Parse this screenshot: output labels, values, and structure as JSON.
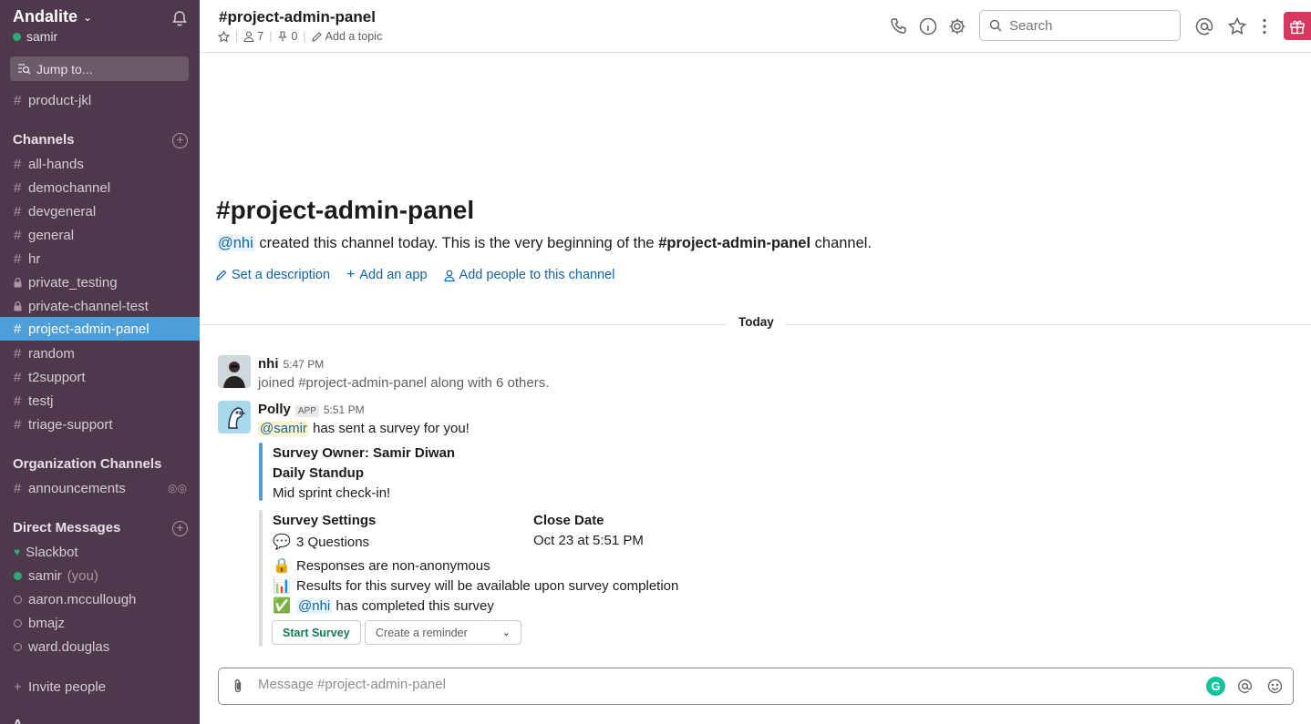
{
  "sidebar": {
    "team_name": "Andalite",
    "user": "samir",
    "jump_placeholder": "Jump to...",
    "pinned": [
      {
        "label": "product-jkl"
      }
    ],
    "channels_title": "Channels",
    "channels": [
      {
        "label": "all-hands",
        "type": "public"
      },
      {
        "label": "demochannel",
        "type": "public"
      },
      {
        "label": "devgeneral",
        "type": "public"
      },
      {
        "label": "general",
        "type": "public"
      },
      {
        "label": "hr",
        "type": "public"
      },
      {
        "label": "private_testing",
        "type": "private"
      },
      {
        "label": "private-channel-test",
        "type": "private"
      },
      {
        "label": "project-admin-panel",
        "type": "public",
        "active": true
      },
      {
        "label": "random",
        "type": "public"
      },
      {
        "label": "t2support",
        "type": "public"
      },
      {
        "label": "testj",
        "type": "public"
      },
      {
        "label": "triage-support",
        "type": "public"
      }
    ],
    "org_title": "Organization Channels",
    "org_channels": [
      {
        "label": "announcements"
      }
    ],
    "dm_title": "Direct Messages",
    "dms": [
      {
        "label": "Slackbot",
        "status": "bot"
      },
      {
        "label": "samir",
        "suffix": "(you)",
        "status": "online"
      },
      {
        "label": "aaron.mccullough",
        "status": "offline"
      },
      {
        "label": "bmajz",
        "status": "offline"
      },
      {
        "label": "ward.douglas",
        "status": "offline"
      }
    ],
    "invite_label": "Invite people",
    "bottom_section_partial": "A"
  },
  "header": {
    "channel_name": "#project-admin-panel",
    "member_count": "7",
    "pin_count": "0",
    "add_topic": "Add a topic",
    "search_placeholder": "Search"
  },
  "intro": {
    "title": "#project-admin-panel",
    "creator": "@nhi",
    "text_before": " created this channel today. This is the very beginning of the ",
    "channel_bold": "#project-admin-panel",
    "text_after": " channel.",
    "actions": {
      "set_description": "Set a description",
      "add_app": "Add an app",
      "add_people": "Add people to this channel"
    }
  },
  "divider_label": "Today",
  "messages": [
    {
      "author": "nhi",
      "time": "5:47 PM",
      "text": "joined #project-admin-panel along with 6 others."
    },
    {
      "author": "Polly",
      "badge": "APP",
      "time": "5:51 PM",
      "mention": "@samir",
      "text": " has sent a survey for you!",
      "survey": {
        "owner": "Survey Owner: Samir Diwan",
        "name": "Daily Standup",
        "desc": "Mid sprint check-in!",
        "settings_title": "Survey Settings",
        "questions": "3 Questions",
        "close_title": "Close Date",
        "close_date": "Oct 23 at 5:51 PM",
        "anonymity": "Responses are non-anonymous",
        "results": "Results for this survey will be available upon survey completion",
        "completed_mention": "@nhi",
        "completed_text": " has completed this survey",
        "start_button": "Start Survey",
        "reminder_select": "Create a reminder"
      }
    }
  ],
  "composer": {
    "placeholder": "Message #project-admin-panel"
  },
  "colors": {
    "sidebar": "#4d394b",
    "active": "#4c9fd9",
    "link": "#1264a3",
    "online": "#2bac76",
    "accent_bar": "#4c9fd9"
  }
}
